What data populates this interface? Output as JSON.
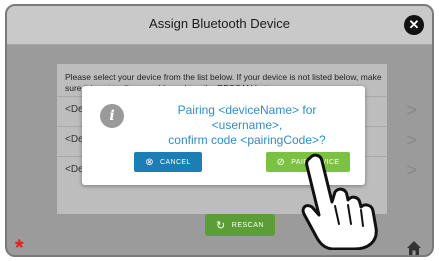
{
  "header": {
    "title": "Assign Bluetooth Device",
    "close_icon": "close-icon"
  },
  "panel": {
    "instructions": "Please select your device from the list below. If your device is not listed below, make sure it is set to discoverable and tap the RESCAN button.",
    "devices": [
      {
        "label": "<Device Name>"
      },
      {
        "label": "<Device Name>"
      },
      {
        "label": "<Device Name>"
      }
    ]
  },
  "rescan_button": {
    "label": "RESCAN",
    "icon": "refresh-icon"
  },
  "dialog": {
    "message_line1": "Pairing <deviceName> for <username>,",
    "message_line2": "confirm code <pairingCode>?",
    "icon": "info-icon",
    "cancel_label": "CANCEL",
    "pair_label": "PAIR DEVICE"
  },
  "footer": {
    "asterisk": "*",
    "home_icon": "home-icon"
  },
  "colors": {
    "dialog_text": "#2f8dc6",
    "cancel_button": "#1b7eb5",
    "pair_button": "#7cc242",
    "rescan_button": "#5a9e35",
    "asterisk": "#e21b1b"
  }
}
